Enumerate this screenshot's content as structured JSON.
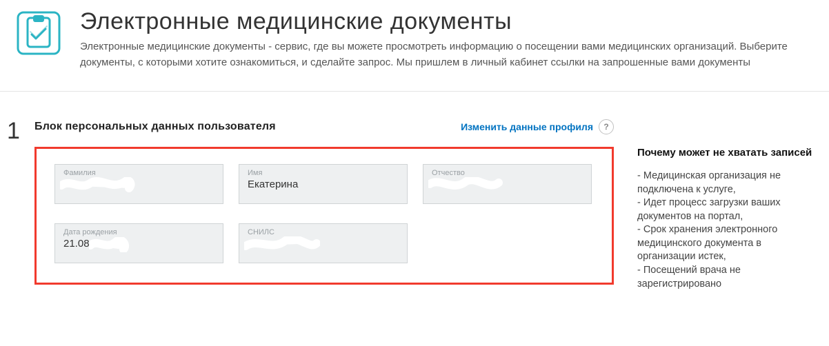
{
  "header": {
    "title": "Электронные медицинские документы",
    "subtitle": "Электронные медицинские документы - сервис, где вы можете просмотреть информацию о посещении вами медицинских организаций. Выберите документы, с которыми хотите ознакомиться, и сделайте запрос. Мы пришлем в личный кабинет ссылки на запрошенные вами документы"
  },
  "step": {
    "number": "1",
    "title": "Блок персональных данных пользователя",
    "edit_link": "Изменить данные профиля",
    "help_label": "?"
  },
  "fields": {
    "surname": {
      "label": "Фамилия",
      "value": ""
    },
    "name": {
      "label": "Имя",
      "value": "Екатерина"
    },
    "patronymic": {
      "label": "Отчество",
      "value": ""
    },
    "dob": {
      "label": "Дата рождения",
      "value": "21.08."
    },
    "snils": {
      "label": "СНИЛС",
      "value": ""
    }
  },
  "sidebar": {
    "title": "Почему может не хватать записей",
    "items": [
      "- Медицинская организация не подключена к услуге,",
      "- Идет процесс загрузки ваших документов на портал,",
      "- Срок хранения электронного медицинского документа в организации истек,",
      "- Посещений врача не зарегистрировано"
    ]
  }
}
